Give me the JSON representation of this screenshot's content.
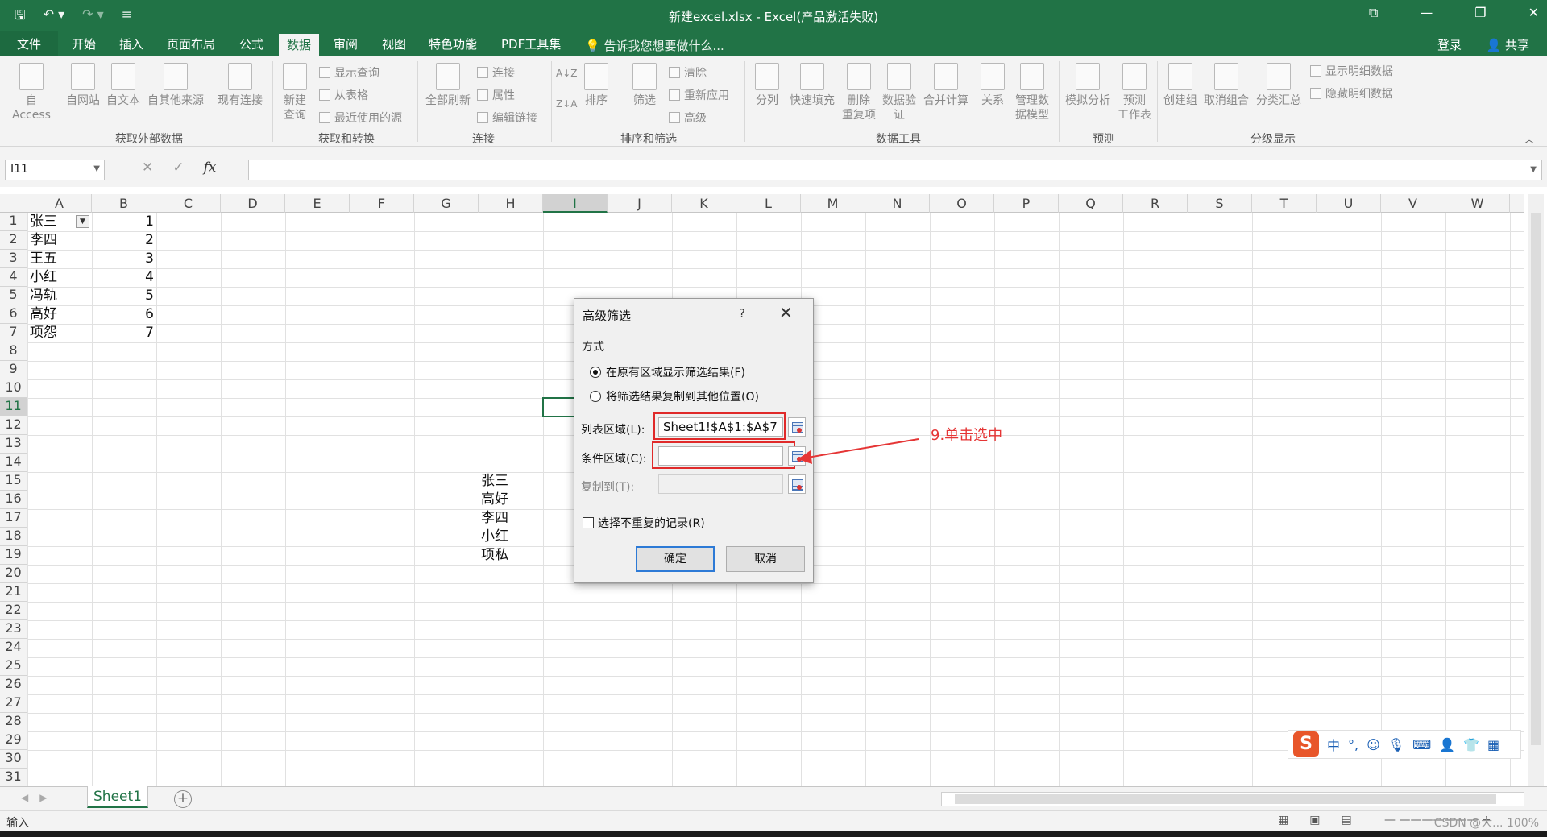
{
  "app": {
    "title": "新建excel.xlsx - Excel(产品激活失败)",
    "qat": [
      "save-icon",
      "undo-icon",
      "redo-icon",
      "customize-icon"
    ],
    "window_controls": [
      "ribbon-options-icon",
      "minimize-icon",
      "restore-icon",
      "close-icon"
    ]
  },
  "tabs": {
    "file": "文件",
    "items": [
      "开始",
      "插入",
      "页面布局",
      "公式",
      "数据",
      "审阅",
      "视图",
      "特色功能",
      "PDF工具集"
    ],
    "active": "数据",
    "tell_me": "告诉我您想要做什么...",
    "login": "登录",
    "share": "共享"
  },
  "ribbon": {
    "get_external": {
      "buttons": [
        "自 Access",
        "自网站",
        "自文本",
        "自其他来源",
        "现有连接"
      ],
      "group": "获取外部数据"
    },
    "get_transform": {
      "new_query": "新建\n查询",
      "small": [
        "显示查询",
        "从表格",
        "最近使用的源"
      ],
      "group": "获取和转换"
    },
    "connections": {
      "refresh_all": "全部刷新",
      "small": [
        "连接",
        "属性",
        "编辑链接"
      ],
      "group": "连接"
    },
    "sort_filter": {
      "sort": "排序",
      "filter": "筛选",
      "small": [
        "清除",
        "重新应用",
        "高级"
      ],
      "group": "排序和筛选"
    },
    "data_tools": {
      "buttons": [
        "分列",
        "快速填充",
        "删除\n重复项",
        "数据验\n证",
        "合并计算",
        "关系",
        "管理数\n据模型"
      ],
      "group": "数据工具"
    },
    "forecast": {
      "buttons": [
        "模拟分析",
        "预测\n工作表"
      ],
      "group": "预测"
    },
    "outline": {
      "buttons": [
        "创建组",
        "取消组合",
        "分类汇总"
      ],
      "small": [
        "显示明细数据",
        "隐藏明细数据"
      ],
      "group": "分级显示"
    }
  },
  "formula_bar": {
    "name_box": "I11",
    "cancel": "✕",
    "enter": "✓",
    "fx": "fx",
    "value": ""
  },
  "sheet": {
    "columns": [
      "A",
      "B",
      "C",
      "D",
      "E",
      "F",
      "G",
      "H",
      "I",
      "J",
      "K",
      "L",
      "M",
      "N",
      "O",
      "P",
      "Q",
      "R",
      "S",
      "T",
      "U",
      "V",
      "W"
    ],
    "selected_column": "I",
    "rows": [
      "1",
      "2",
      "3",
      "4",
      "5",
      "6",
      "7",
      "8",
      "9",
      "10",
      "11",
      "12",
      "13",
      "14",
      "15",
      "16",
      "17",
      "18",
      "19",
      "20",
      "21",
      "22",
      "23",
      "24",
      "25",
      "26",
      "27",
      "28",
      "29",
      "30",
      "31"
    ],
    "selected_row": "11",
    "col_a": [
      "张三",
      "李四",
      "王五",
      "小红",
      "冯轨",
      "高好",
      "项怨"
    ],
    "col_b": [
      "1",
      "2",
      "3",
      "4",
      "5",
      "6",
      "7"
    ],
    "col_h": [
      "张三",
      "高好",
      "李四",
      "小红",
      "项私"
    ],
    "tab": "Sheet1",
    "add_sheet": "+"
  },
  "status": {
    "mode": "输入",
    "zoom": "100%",
    "watermark": "CSDN @大..."
  },
  "dialog": {
    "title": "高级筛选",
    "help": "?",
    "close": "✕",
    "section": "方式",
    "radio1": "在原有区域显示筛选结果(F)",
    "radio2": "将筛选结果复制到其他位置(O)",
    "list_range_label": "列表区域(L):",
    "list_range_value": "Sheet1!$A$1:$A$7",
    "criteria_label": "条件区域(C):",
    "criteria_value": "",
    "copy_to_label": "复制到(T):",
    "copy_to_value": "",
    "unique_label": "选择不重复的记录(R)",
    "ok": "确定",
    "cancel": "取消"
  },
  "annotation": {
    "text": "9.单击选中",
    "color": "#e53535"
  },
  "ime": {
    "logo": "S",
    "items": [
      "中",
      "°,",
      "☺",
      "🎙",
      "⌨",
      "👤",
      "👕",
      "▦"
    ]
  },
  "colors": {
    "excel_green": "#217346",
    "highlight_red": "#e02a2a",
    "ok_border": "#2d7ad6"
  }
}
